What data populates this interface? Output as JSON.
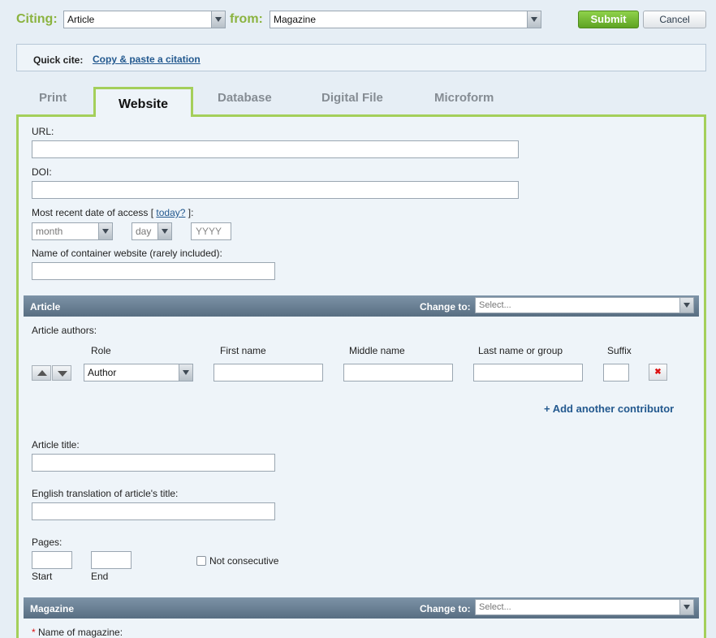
{
  "top": {
    "citing_label": "Citing:",
    "citing_value": "Article",
    "from_label": "from:",
    "from_value": "Magazine",
    "submit_label": "Submit",
    "cancel_label": "Cancel"
  },
  "quick_cite": {
    "label": "Quick cite:",
    "link": "Copy & paste a citation"
  },
  "tabs": [
    {
      "label": "Print",
      "active": false
    },
    {
      "label": "Website",
      "active": true
    },
    {
      "label": "Database",
      "active": false
    },
    {
      "label": "Digital File",
      "active": false
    },
    {
      "label": "Microform",
      "active": false
    }
  ],
  "website": {
    "url_label": "URL:",
    "doi_label": "DOI:",
    "access_label_pre": "Most recent date of access [ ",
    "access_today_link": "today?",
    "access_label_post": " ]:",
    "month_value": "month",
    "day_value": "day",
    "year_placeholder": "YYYY",
    "container_label": "Name of container website (rarely included):"
  },
  "article_section": {
    "title": "Article",
    "change_to_label": "Change to:",
    "change_to_value": "Select...",
    "authors_label": "Article authors:",
    "columns": [
      "Role",
      "First name",
      "Middle name",
      "Last name or group",
      "Suffix"
    ],
    "role_value": "Author",
    "delete_glyph": "✖",
    "add_contributor": "+ Add another contributor",
    "title_label": "Article title:",
    "translation_label": "English translation of article's title:",
    "pages_label": "Pages:",
    "start_label": "Start",
    "end_label": "End",
    "not_consecutive_label": "Not consecutive"
  },
  "magazine_section": {
    "title": "Magazine",
    "change_to_label": "Change to:",
    "change_to_value": "Select...",
    "required_mark": "*",
    "name_label": "Name of magazine:"
  },
  "colors": {
    "accent_green": "#8bb33f",
    "tab_border": "#a4cf5a",
    "link_blue": "#23598f",
    "section_bar": "#586e82"
  }
}
